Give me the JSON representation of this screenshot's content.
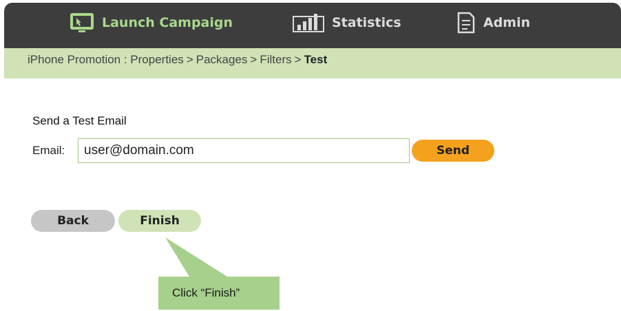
{
  "nav": {
    "launch": {
      "label": "Launch Campaign",
      "icon": "monitor-cursor-icon"
    },
    "statistics": {
      "label": "Statistics",
      "icon": "bar-chart-icon"
    },
    "admin": {
      "label": "Admin",
      "icon": "document-icon"
    }
  },
  "breadcrumb": {
    "items": [
      "iPhone Promotion : Properties",
      "Packages",
      "Filters"
    ],
    "separator": ">",
    "current": "Test"
  },
  "form": {
    "title": "Send a Test Email",
    "email_label": "Email:",
    "email_value": "user@domain.com",
    "send_label": "Send"
  },
  "actions": {
    "back_label": "Back",
    "finish_label": "Finish"
  },
  "callout": {
    "text": "Click “Finish”"
  },
  "colors": {
    "topbar": "#3d3d3d",
    "breadcrumb_bg": "#cfe3b6",
    "send": "#f4a21e",
    "back": "#c6c6c6",
    "finish": "#cfe3b6",
    "callout": "#a6d08b"
  }
}
